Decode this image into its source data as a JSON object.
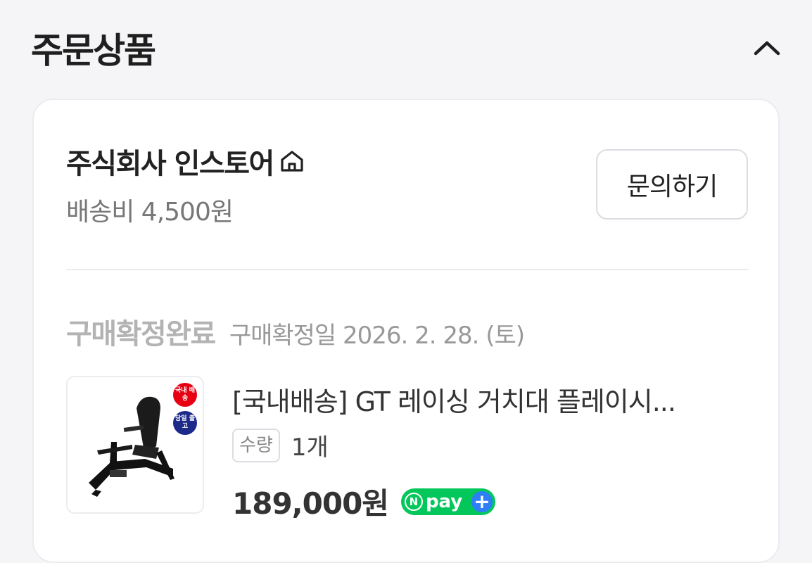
{
  "section": {
    "title": "주문상품",
    "toggle_icon": "chevron-up-icon"
  },
  "store": {
    "name": "주식회사 인스토어",
    "home_icon": "home-icon",
    "shipping_fee": "배송비 4,500원",
    "inquiry_label": "문의하기"
  },
  "order": {
    "status": "구매확정완료",
    "confirm_date": "구매확정일 2026. 2. 28. (토)"
  },
  "product": {
    "badge_domestic": "국내 배송",
    "badge_sameday": "당일 출고",
    "title": "[국내배송] GT 레이싱 거치대 플레이시...",
    "qty_label": "수량",
    "qty_value": "1개",
    "price": "189,000원",
    "payment": {
      "n": "N",
      "label": "pay",
      "plus": "+",
      "color": "#03c75a",
      "plus_color": "#2d7ef7"
    }
  }
}
